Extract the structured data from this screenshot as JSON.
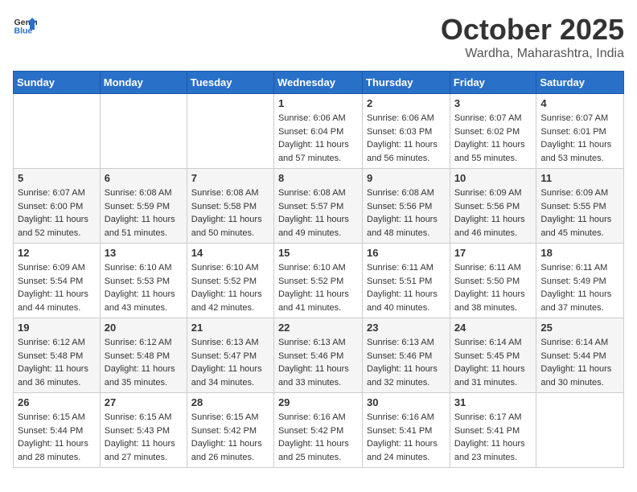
{
  "header": {
    "logo_general": "General",
    "logo_blue": "Blue",
    "title": "October 2025",
    "location": "Wardha, Maharashtra, India"
  },
  "weekdays": [
    "Sunday",
    "Monday",
    "Tuesday",
    "Wednesday",
    "Thursday",
    "Friday",
    "Saturday"
  ],
  "weeks": [
    [
      {
        "day": "",
        "sunrise": "",
        "sunset": "",
        "daylight": ""
      },
      {
        "day": "",
        "sunrise": "",
        "sunset": "",
        "daylight": ""
      },
      {
        "day": "",
        "sunrise": "",
        "sunset": "",
        "daylight": ""
      },
      {
        "day": "1",
        "sunrise": "Sunrise: 6:06 AM",
        "sunset": "Sunset: 6:04 PM",
        "daylight": "Daylight: 11 hours and 57 minutes."
      },
      {
        "day": "2",
        "sunrise": "Sunrise: 6:06 AM",
        "sunset": "Sunset: 6:03 PM",
        "daylight": "Daylight: 11 hours and 56 minutes."
      },
      {
        "day": "3",
        "sunrise": "Sunrise: 6:07 AM",
        "sunset": "Sunset: 6:02 PM",
        "daylight": "Daylight: 11 hours and 55 minutes."
      },
      {
        "day": "4",
        "sunrise": "Sunrise: 6:07 AM",
        "sunset": "Sunset: 6:01 PM",
        "daylight": "Daylight: 11 hours and 53 minutes."
      }
    ],
    [
      {
        "day": "5",
        "sunrise": "Sunrise: 6:07 AM",
        "sunset": "Sunset: 6:00 PM",
        "daylight": "Daylight: 11 hours and 52 minutes."
      },
      {
        "day": "6",
        "sunrise": "Sunrise: 6:08 AM",
        "sunset": "Sunset: 5:59 PM",
        "daylight": "Daylight: 11 hours and 51 minutes."
      },
      {
        "day": "7",
        "sunrise": "Sunrise: 6:08 AM",
        "sunset": "Sunset: 5:58 PM",
        "daylight": "Daylight: 11 hours and 50 minutes."
      },
      {
        "day": "8",
        "sunrise": "Sunrise: 6:08 AM",
        "sunset": "Sunset: 5:57 PM",
        "daylight": "Daylight: 11 hours and 49 minutes."
      },
      {
        "day": "9",
        "sunrise": "Sunrise: 6:08 AM",
        "sunset": "Sunset: 5:56 PM",
        "daylight": "Daylight: 11 hours and 48 minutes."
      },
      {
        "day": "10",
        "sunrise": "Sunrise: 6:09 AM",
        "sunset": "Sunset: 5:56 PM",
        "daylight": "Daylight: 11 hours and 46 minutes."
      },
      {
        "day": "11",
        "sunrise": "Sunrise: 6:09 AM",
        "sunset": "Sunset: 5:55 PM",
        "daylight": "Daylight: 11 hours and 45 minutes."
      }
    ],
    [
      {
        "day": "12",
        "sunrise": "Sunrise: 6:09 AM",
        "sunset": "Sunset: 5:54 PM",
        "daylight": "Daylight: 11 hours and 44 minutes."
      },
      {
        "day": "13",
        "sunrise": "Sunrise: 6:10 AM",
        "sunset": "Sunset: 5:53 PM",
        "daylight": "Daylight: 11 hours and 43 minutes."
      },
      {
        "day": "14",
        "sunrise": "Sunrise: 6:10 AM",
        "sunset": "Sunset: 5:52 PM",
        "daylight": "Daylight: 11 hours and 42 minutes."
      },
      {
        "day": "15",
        "sunrise": "Sunrise: 6:10 AM",
        "sunset": "Sunset: 5:52 PM",
        "daylight": "Daylight: 11 hours and 41 minutes."
      },
      {
        "day": "16",
        "sunrise": "Sunrise: 6:11 AM",
        "sunset": "Sunset: 5:51 PM",
        "daylight": "Daylight: 11 hours and 40 minutes."
      },
      {
        "day": "17",
        "sunrise": "Sunrise: 6:11 AM",
        "sunset": "Sunset: 5:50 PM",
        "daylight": "Daylight: 11 hours and 38 minutes."
      },
      {
        "day": "18",
        "sunrise": "Sunrise: 6:11 AM",
        "sunset": "Sunset: 5:49 PM",
        "daylight": "Daylight: 11 hours and 37 minutes."
      }
    ],
    [
      {
        "day": "19",
        "sunrise": "Sunrise: 6:12 AM",
        "sunset": "Sunset: 5:48 PM",
        "daylight": "Daylight: 11 hours and 36 minutes."
      },
      {
        "day": "20",
        "sunrise": "Sunrise: 6:12 AM",
        "sunset": "Sunset: 5:48 PM",
        "daylight": "Daylight: 11 hours and 35 minutes."
      },
      {
        "day": "21",
        "sunrise": "Sunrise: 6:13 AM",
        "sunset": "Sunset: 5:47 PM",
        "daylight": "Daylight: 11 hours and 34 minutes."
      },
      {
        "day": "22",
        "sunrise": "Sunrise: 6:13 AM",
        "sunset": "Sunset: 5:46 PM",
        "daylight": "Daylight: 11 hours and 33 minutes."
      },
      {
        "day": "23",
        "sunrise": "Sunrise: 6:13 AM",
        "sunset": "Sunset: 5:46 PM",
        "daylight": "Daylight: 11 hours and 32 minutes."
      },
      {
        "day": "24",
        "sunrise": "Sunrise: 6:14 AM",
        "sunset": "Sunset: 5:45 PM",
        "daylight": "Daylight: 11 hours and 31 minutes."
      },
      {
        "day": "25",
        "sunrise": "Sunrise: 6:14 AM",
        "sunset": "Sunset: 5:44 PM",
        "daylight": "Daylight: 11 hours and 30 minutes."
      }
    ],
    [
      {
        "day": "26",
        "sunrise": "Sunrise: 6:15 AM",
        "sunset": "Sunset: 5:44 PM",
        "daylight": "Daylight: 11 hours and 28 minutes."
      },
      {
        "day": "27",
        "sunrise": "Sunrise: 6:15 AM",
        "sunset": "Sunset: 5:43 PM",
        "daylight": "Daylight: 11 hours and 27 minutes."
      },
      {
        "day": "28",
        "sunrise": "Sunrise: 6:15 AM",
        "sunset": "Sunset: 5:42 PM",
        "daylight": "Daylight: 11 hours and 26 minutes."
      },
      {
        "day": "29",
        "sunrise": "Sunrise: 6:16 AM",
        "sunset": "Sunset: 5:42 PM",
        "daylight": "Daylight: 11 hours and 25 minutes."
      },
      {
        "day": "30",
        "sunrise": "Sunrise: 6:16 AM",
        "sunset": "Sunset: 5:41 PM",
        "daylight": "Daylight: 11 hours and 24 minutes."
      },
      {
        "day": "31",
        "sunrise": "Sunrise: 6:17 AM",
        "sunset": "Sunset: 5:41 PM",
        "daylight": "Daylight: 11 hours and 23 minutes."
      },
      {
        "day": "",
        "sunrise": "",
        "sunset": "",
        "daylight": ""
      }
    ]
  ]
}
